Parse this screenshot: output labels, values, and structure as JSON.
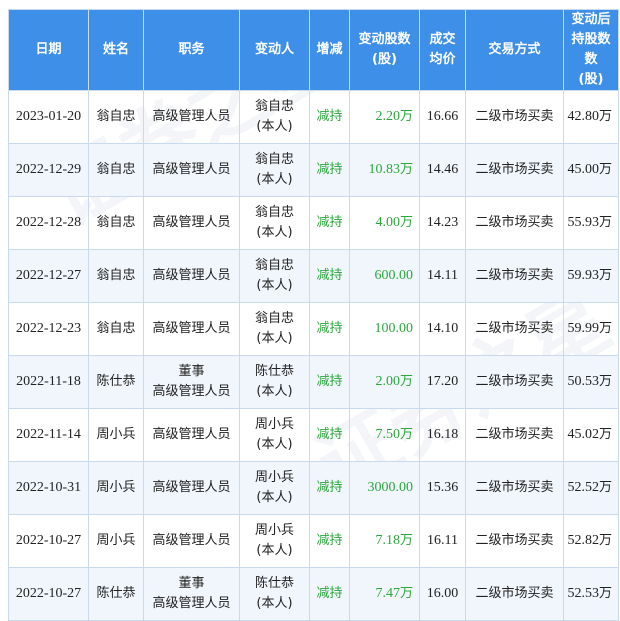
{
  "headers": {
    "date": "日期",
    "name": "姓名",
    "position": "职务",
    "changer": "变动人",
    "direction": "增减",
    "shares_l1": "变动股数",
    "shares_l2": "(股)",
    "price_l1": "成交",
    "price_l2": "均价",
    "method": "交易方式",
    "hold_l1": "变动后",
    "hold_l2": "持股数数",
    "hold_l3": "(股)"
  },
  "rows": [
    {
      "date": "2023-01-20",
      "name": "翁自忠",
      "pos1": "高级管理人员",
      "pos2": "",
      "changer": "翁自忠",
      "changer2": "(本人)",
      "direction": "减持",
      "shares": "2.20",
      "shares_unit": "万",
      "price": "16.66",
      "method": "二级市场买卖",
      "hold": "42.80",
      "hold_unit": "万"
    },
    {
      "date": "2022-12-29",
      "name": "翁自忠",
      "pos1": "高级管理人员",
      "pos2": "",
      "changer": "翁自忠",
      "changer2": "(本人)",
      "direction": "减持",
      "shares": "10.83",
      "shares_unit": "万",
      "price": "14.46",
      "method": "二级市场买卖",
      "hold": "45.00",
      "hold_unit": "万"
    },
    {
      "date": "2022-12-28",
      "name": "翁自忠",
      "pos1": "高级管理人员",
      "pos2": "",
      "changer": "翁自忠",
      "changer2": "(本人)",
      "direction": "减持",
      "shares": "4.00",
      "shares_unit": "万",
      "price": "14.23",
      "method": "二级市场买卖",
      "hold": "55.93",
      "hold_unit": "万"
    },
    {
      "date": "2022-12-27",
      "name": "翁自忠",
      "pos1": "高级管理人员",
      "pos2": "",
      "changer": "翁自忠",
      "changer2": "(本人)",
      "direction": "减持",
      "shares": "600.00",
      "shares_unit": "",
      "price": "14.11",
      "method": "二级市场买卖",
      "hold": "59.93",
      "hold_unit": "万"
    },
    {
      "date": "2022-12-23",
      "name": "翁自忠",
      "pos1": "高级管理人员",
      "pos2": "",
      "changer": "翁自忠",
      "changer2": "(本人)",
      "direction": "减持",
      "shares": "100.00",
      "shares_unit": "",
      "price": "14.10",
      "method": "二级市场买卖",
      "hold": "59.99",
      "hold_unit": "万"
    },
    {
      "date": "2022-11-18",
      "name": "陈仕恭",
      "pos1": "董事",
      "pos2": "高级管理人员",
      "changer": "陈仕恭",
      "changer2": "(本人)",
      "direction": "减持",
      "shares": "2.00",
      "shares_unit": "万",
      "price": "17.20",
      "method": "二级市场买卖",
      "hold": "50.53",
      "hold_unit": "万"
    },
    {
      "date": "2022-11-14",
      "name": "周小兵",
      "pos1": "高级管理人员",
      "pos2": "",
      "changer": "周小兵",
      "changer2": "(本人)",
      "direction": "减持",
      "shares": "7.50",
      "shares_unit": "万",
      "price": "16.18",
      "method": "二级市场买卖",
      "hold": "45.02",
      "hold_unit": "万"
    },
    {
      "date": "2022-10-31",
      "name": "周小兵",
      "pos1": "高级管理人员",
      "pos2": "",
      "changer": "周小兵",
      "changer2": "(本人)",
      "direction": "减持",
      "shares": "3000.00",
      "shares_unit": "",
      "price": "15.36",
      "method": "二级市场买卖",
      "hold": "52.52",
      "hold_unit": "万"
    },
    {
      "date": "2022-10-27",
      "name": "周小兵",
      "pos1": "高级管理人员",
      "pos2": "",
      "changer": "周小兵",
      "changer2": "(本人)",
      "direction": "减持",
      "shares": "7.18",
      "shares_unit": "万",
      "price": "16.11",
      "method": "二级市场买卖",
      "hold": "52.82",
      "hold_unit": "万"
    },
    {
      "date": "2022-10-27",
      "name": "陈仕恭",
      "pos1": "董事",
      "pos2": "高级管理人员",
      "changer": "陈仕恭",
      "changer2": "(本人)",
      "direction": "减持",
      "shares": "7.47",
      "shares_unit": "万",
      "price": "16.00",
      "method": "二级市场买卖",
      "hold": "52.53",
      "hold_unit": "万"
    }
  ],
  "watermark": "证券之星",
  "colors": {
    "header_bg": "#3d8fe8",
    "decrease": "#2aa83b",
    "border": "#c9d9ee",
    "stripe": "#f1f6fc"
  }
}
